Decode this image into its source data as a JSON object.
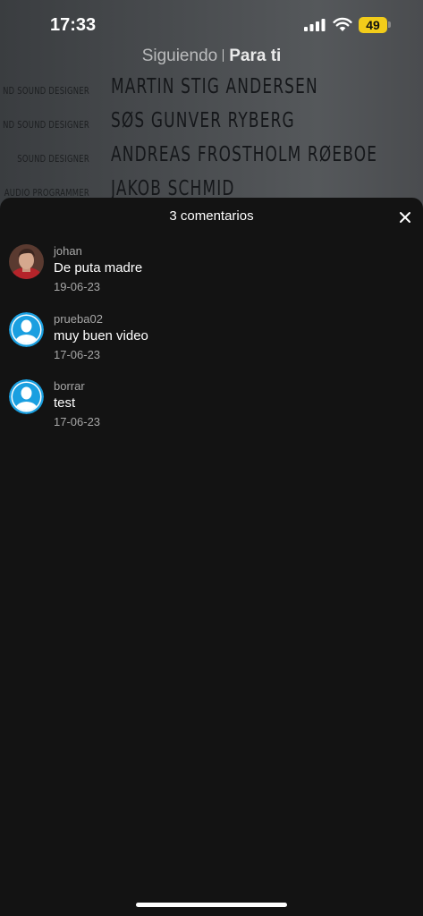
{
  "status_bar": {
    "time": "17:33",
    "battery": "49"
  },
  "feed_tabs": {
    "following": "Siguiendo",
    "for_you": "Para ti"
  },
  "video_credits": [
    {
      "role": "ND SOUND DESIGNER",
      "name": "MARTIN STIG ANDERSEN"
    },
    {
      "role": "ND SOUND DESIGNER",
      "name": "SØS GUNVER RYBERG"
    },
    {
      "role": "SOUND DESIGNER",
      "name": "ANDREAS FROSTHOLM RØEBOE"
    },
    {
      "role": "AUDIO PROGRAMMER",
      "name": "JAKOB SCHMID"
    }
  ],
  "comments_sheet": {
    "title": "3 comentarios",
    "comments": [
      {
        "user": "johan",
        "text": "De puta madre",
        "date": "19-06-23",
        "avatar": "photo"
      },
      {
        "user": "prueba02",
        "text": "muy buen video",
        "date": "17-06-23",
        "avatar": "default-user-icon"
      },
      {
        "user": "borrar",
        "text": "test",
        "date": "17-06-23",
        "avatar": "default-user-icon"
      }
    ]
  },
  "colors": {
    "sheet_bg": "#131313",
    "default_avatar": "#1a9fe0",
    "battery": "#f2cc1a"
  }
}
